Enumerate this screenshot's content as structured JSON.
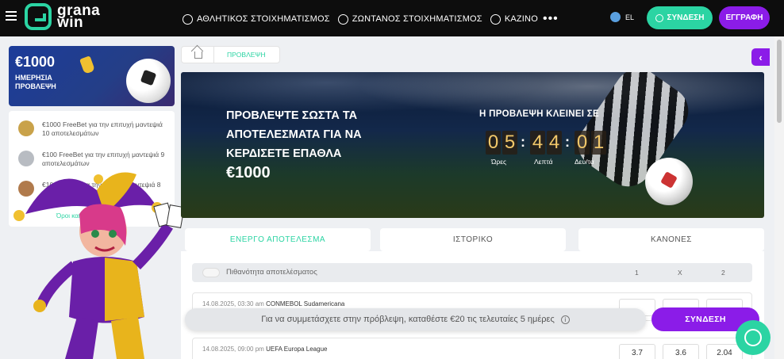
{
  "header": {
    "logo_top": "grana",
    "logo_bottom": "win",
    "nav": [
      {
        "label": "ΑΘΛΗΤΙΚΟΣ ΣΤΟΙΧΗΜΑΤΙΣΜΟΣ",
        "icon": "soccer-ball-icon"
      },
      {
        "label": "ΖΩΝΤΑΝΟΣ ΣΤΟΙΧΗΜΑΤΙΣΜΟΣ",
        "icon": "live-icon"
      },
      {
        "label": "ΚΑΖΙΝΟ",
        "icon": "casino-chip-icon"
      }
    ],
    "more": "•••",
    "language": "EL",
    "login_label": "ΣΥΝΔΕΣΗ",
    "register_label": "ΕΓΓΡΑΦΗ"
  },
  "promo": {
    "amount": "€1000",
    "subtitle_line1": "ΗΜΕΡΗΣΙΑ",
    "subtitle_line2": "ΠΡΟΒΛΕΨΗ"
  },
  "prizes": [
    {
      "text": "€1000 FreeBet για την επιτυχή μαντεψιά 10 αποτελεσμάτων",
      "medal_color": "#c9a24a"
    },
    {
      "text": "€100 FreeBet για την επιτυχή μαντεψιά 9 αποτελεσμάτων",
      "medal_color": "#b8bcc2"
    },
    {
      "text": "€10 FreeBet για την επιτυχή μαντεψιά 8 αποτελεσμάτων",
      "medal_color": "#b07a4c"
    }
  ],
  "prizes_link": "Όροι και προϋποθέσεις",
  "breadcrumb": {
    "current": "ΠΡΟΒΛΕΨΗ"
  },
  "hero": {
    "title": "ΠΡΟΒΛΕΨΤΕ ΣΩΣΤΑ ΤΑ ΑΠΟΤΕΛΕΣΜΑΤΑ ΓΙΑ ΝΑ ΚΕΡΔΙΣΕΤΕ ΕΠΑΘΛΑ",
    "amount": "€1000",
    "countdown_label": "Η ΠΡΟΒΛΕΨΗ ΚΛΕΙΝΕΙ ΣΕ",
    "hours": [
      "0",
      "5"
    ],
    "minutes": [
      "4",
      "4"
    ],
    "seconds": [
      "0",
      "1"
    ],
    "hours_label": "Ώρες",
    "minutes_label": "Λεπτά",
    "seconds_label": "Δευ/τα"
  },
  "tabs": [
    {
      "label": "ΕΝΕΡΓΟ ΑΠΟΤΕΛΕΣΜΑ",
      "active": true
    },
    {
      "label": "ΙΣΤΟΡΙΚΟ",
      "active": false
    },
    {
      "label": "ΚΑΝΟΝΕΣ",
      "active": false
    }
  ],
  "odds_header": {
    "title": "Πιθανότητα αποτελέσματος",
    "cols": [
      "1",
      "X",
      "2"
    ]
  },
  "matches": [
    {
      "date": "14.08.2025, 03:30 am",
      "league": "CONMEBOL Sudamericana",
      "odds": [
        "",
        "",
        ""
      ]
    },
    {
      "date": "14.08.2025, 09:00 pm",
      "league": "UEFA Europa League",
      "odds": [
        "3.7",
        "3.6",
        "2.04"
      ]
    }
  ],
  "notice": {
    "text": "Για να συμμετάσχετε στην πρόβλεψη, καταθέστε €20 τις τελευταίες 5 ημέρες",
    "button": "ΣΥΝΔΕΣΗ"
  },
  "colors": {
    "accent": "#2bd4a3",
    "brand_purple": "#8b1ce8"
  }
}
